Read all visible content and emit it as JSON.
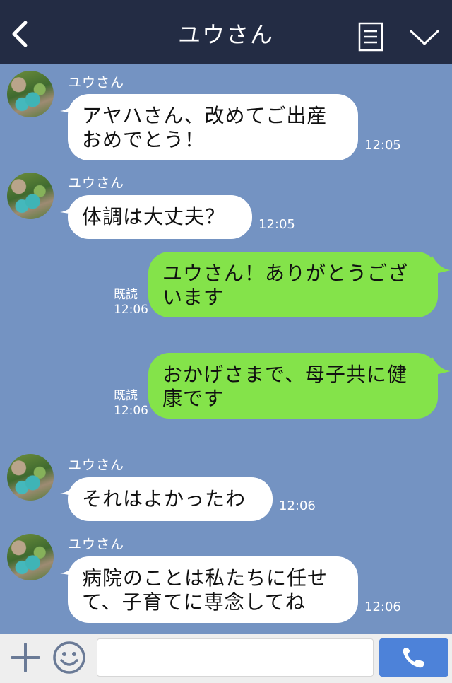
{
  "header": {
    "title": "ユウさん"
  },
  "messages": [
    {
      "from": "ユウさん",
      "text_lines": [
        "アヤハさん、改めてご出産",
        "おめでとう！"
      ],
      "time": "12:05"
    },
    {
      "from": "ユウさん",
      "text_lines": [
        "体調は大丈夫？"
      ],
      "time": "12:05"
    },
    {
      "from": "me",
      "text_lines": [
        "ユウさん！ありがとうござ",
        "います"
      ],
      "read": "既読",
      "time": "12:06"
    },
    {
      "from": "me",
      "text_lines": [
        "おかげさまで、母子共に健",
        "康です"
      ],
      "read": "既読",
      "time": "12:06"
    },
    {
      "from": "ユウさん",
      "text_lines": [
        "それはよかったわ"
      ],
      "time": "12:06"
    },
    {
      "from": "ユウさん",
      "text_lines": [
        "病院のことは私たちに任せ",
        "て、子育てに専念してね"
      ],
      "time": "12:06"
    }
  ],
  "footer": {
    "input_placeholder": ""
  },
  "colors": {
    "header_bg": "#232c44",
    "chat_bg": "#7493c2",
    "incoming_bubble": "#ffffff",
    "outgoing_bubble": "#84e34a",
    "send_button": "#4d82d9"
  },
  "icons": [
    "back-icon",
    "menu-icon",
    "chevron-down-icon",
    "plus-icon",
    "smile-icon",
    "phone-icon"
  ]
}
